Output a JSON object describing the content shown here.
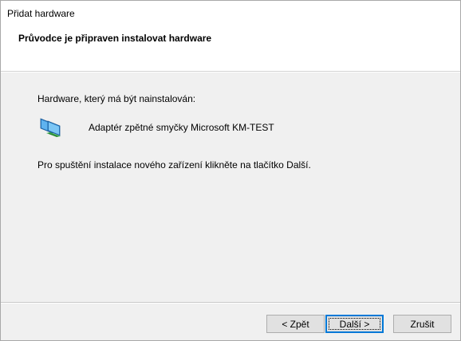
{
  "window": {
    "title": "Přidat hardware"
  },
  "header": {
    "heading": "Průvodce je připraven instalovat hardware"
  },
  "content": {
    "hardware_label": "Hardware, který má být nainstalován:",
    "device_name": "Adaptér zpětné smyčky Microsoft KM-TEST",
    "device_icon": "network-adapter-icon",
    "instruction": "Pro spuštění instalace nového zařízení klikněte na tlačítko Další."
  },
  "buttons": {
    "back_label": "< Zpět",
    "next_label": "Další >",
    "cancel_label": "Zrušit"
  }
}
